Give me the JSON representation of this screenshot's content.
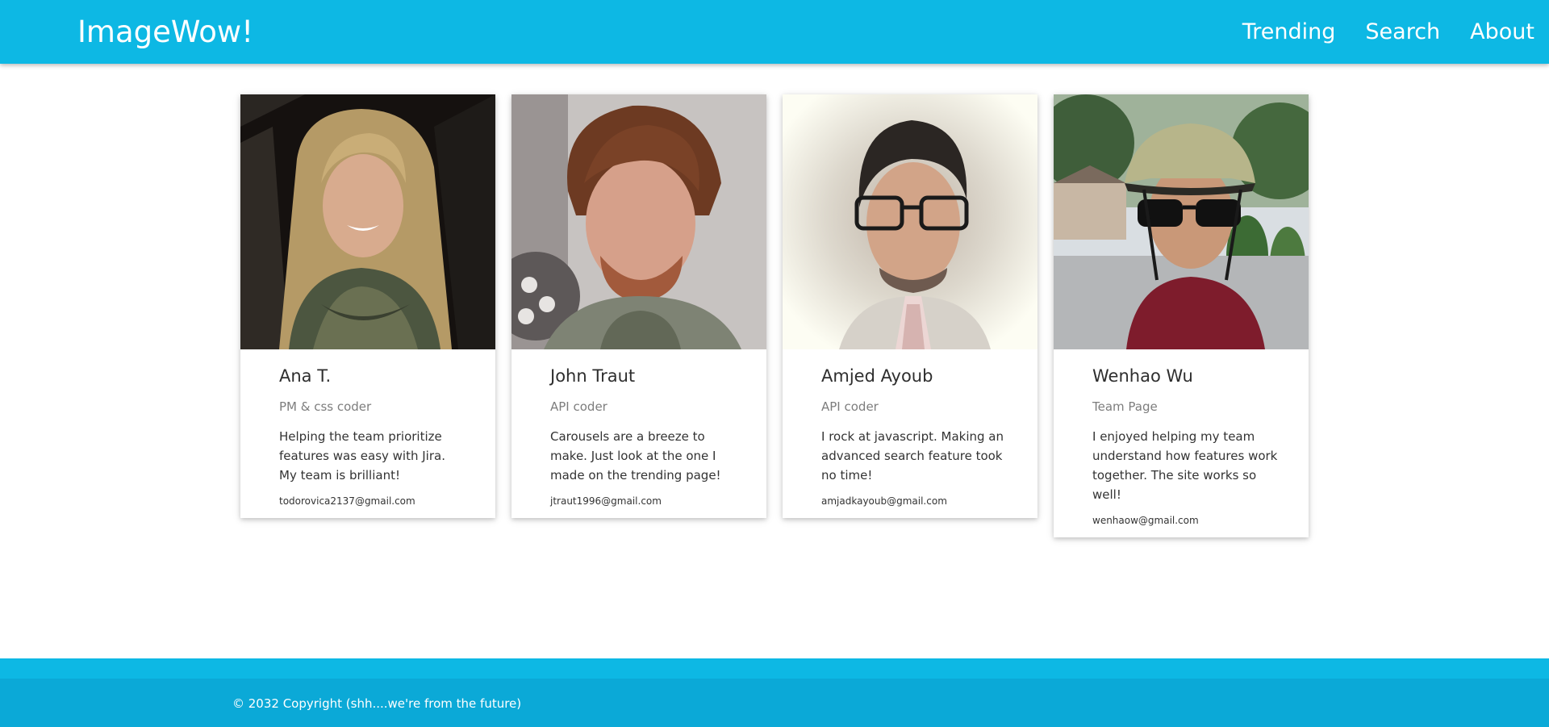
{
  "header": {
    "brand": "ImageWow!",
    "nav": [
      "Trending",
      "Search",
      "About"
    ]
  },
  "team": [
    {
      "name": "Ana T.",
      "role": "PM & css coder",
      "bio": "Helping the team prioritize features was easy with Jira. My team is brilliant!",
      "email": "todorovica2137@gmail.com",
      "photo": "portrait-smiling-woman-long-blonde-hair-scarf"
    },
    {
      "name": "John Traut",
      "role": "API coder",
      "bio": "Carousels are a breeze to make. Just look at the one I made on the trending page!",
      "email": "jtraut1996@gmail.com",
      "photo": "portrait-man-curly-auburn-hair-beard-hoodie"
    },
    {
      "name": "Amjed Ayoub",
      "role": "API coder",
      "bio": "I rock at javascript. Making an advanced search feature took no time!",
      "email": "amjadkayoub@gmail.com",
      "photo": "portrait-man-glasses-suit-faded-vignette"
    },
    {
      "name": "Wenhao Wu",
      "role": "Team Page",
      "bio": "I enjoyed helping my team understand how features work together. The site works so well!",
      "email": "wenhaow@gmail.com",
      "photo": "selfie-man-bike-helmet-sunglasses-street"
    }
  ],
  "footer": {
    "copyright": "© 2032 Copyright (shh....we're from the future)"
  },
  "colors": {
    "primary": "#0db8e4",
    "footer_dark": "#0ba9d7",
    "text_muted": "#7d7d7d"
  }
}
